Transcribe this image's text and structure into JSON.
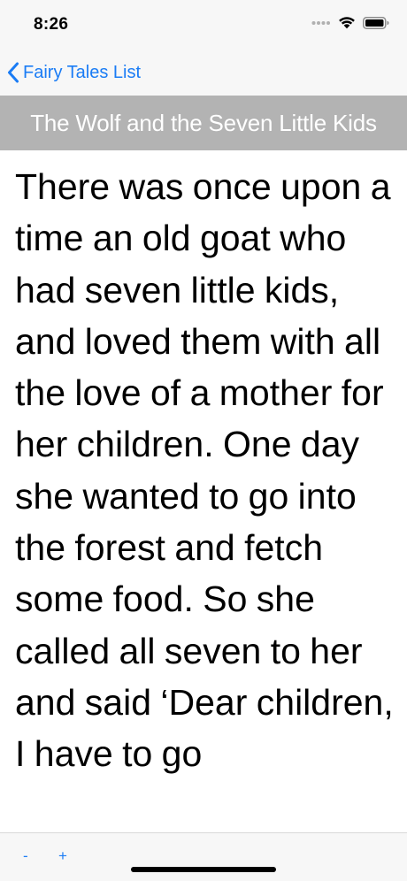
{
  "status_bar": {
    "time": "8:26",
    "icons": [
      "signal-icon",
      "wifi-icon",
      "battery-icon"
    ]
  },
  "nav": {
    "back_label": "Fairy Tales List",
    "back_icon": "chevron-left-icon"
  },
  "story": {
    "title": "The Wolf and the Seven Little Kids",
    "text": "There was once upon a time an old goat who had seven little kids, and loved them with all the love of a mother for her children. One day she wanted to go into the forest and fetch some food. So she called all seven to her and said ‘Dear children, I have to go"
  },
  "toolbar": {
    "decrease_label": "-",
    "increase_label": "+"
  },
  "colors": {
    "accent": "#1a7cf5",
    "banner": "#b3b3b3",
    "bar_background": "#f7f7f7"
  }
}
